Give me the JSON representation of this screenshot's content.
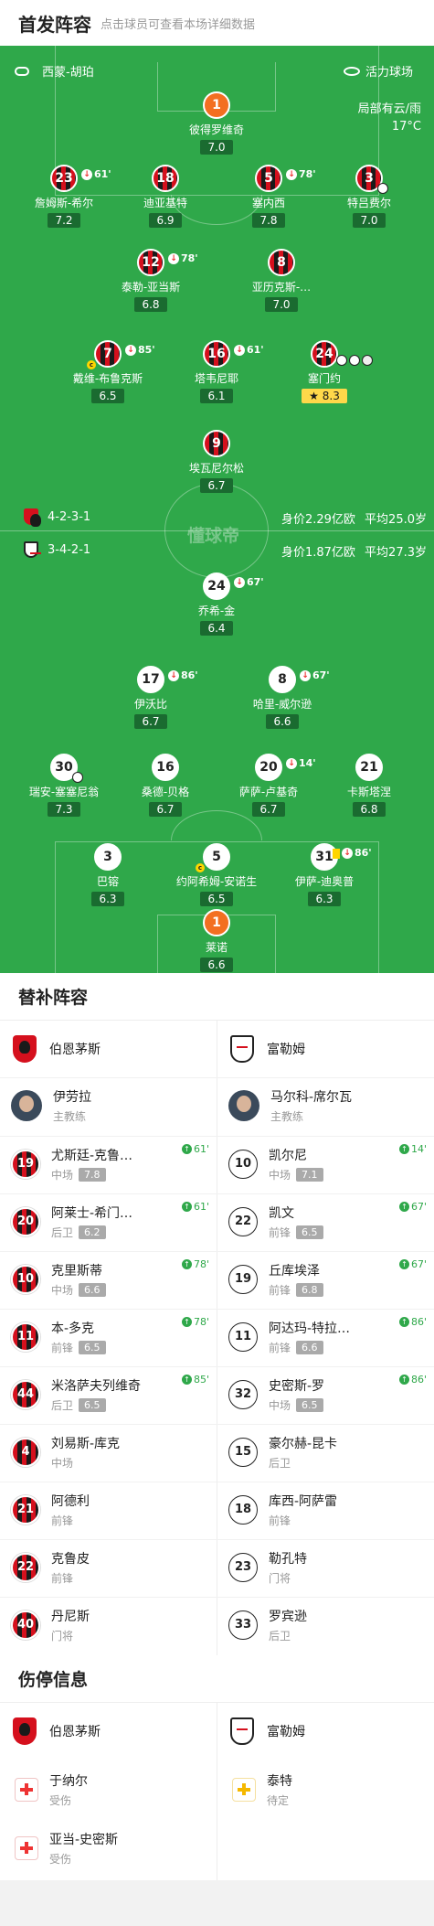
{
  "header": {
    "title": "首发阵容",
    "subtitle": "点击球员可查看本场详细数据"
  },
  "pitch": {
    "referee": "西蒙-胡珀",
    "stadium": "活力球场",
    "weather": "局部有云/雨",
    "temperature": "17°C",
    "watermark": "懂球帝",
    "home_formation": "4-2-3-1",
    "home_value": "身价2.29亿欧",
    "home_age": "平均25.0岁",
    "away_formation": "3-4-2-1",
    "away_value": "身价1.87亿欧",
    "away_age": "平均27.3岁"
  },
  "home_players": [
    {
      "num": "1",
      "name": "彼得罗维奇",
      "rating": "7.0",
      "kit": "gk"
    },
    {
      "num": "23",
      "name": "詹姆斯-希尔",
      "rating": "7.2",
      "sub": "61'"
    },
    {
      "num": "18",
      "name": "迪亚基特",
      "rating": "6.9"
    },
    {
      "num": "5",
      "name": "塞内西",
      "rating": "7.8",
      "sub": "78'"
    },
    {
      "num": "3",
      "name": "特吕费尔",
      "rating": "7.0"
    },
    {
      "num": "12",
      "name": "泰勒-亚当斯",
      "rating": "6.8",
      "sub": "78'"
    },
    {
      "num": "8",
      "name": "亚历克斯-…",
      "rating": "7.0"
    },
    {
      "num": "7",
      "name": "戴维-布鲁克斯",
      "rating": "6.5",
      "sub": "85'"
    },
    {
      "num": "16",
      "name": "塔韦尼耶",
      "rating": "6.1",
      "sub": "61'"
    },
    {
      "num": "24",
      "name": "塞门约",
      "rating": "8.3"
    },
    {
      "num": "9",
      "name": "埃瓦尼尔松",
      "rating": "6.7"
    }
  ],
  "away_players": [
    {
      "num": "24",
      "name": "乔希-金",
      "rating": "6.4",
      "sub": "67'"
    },
    {
      "num": "17",
      "name": "伊沃比",
      "rating": "6.7",
      "sub": "86'"
    },
    {
      "num": "8",
      "name": "哈里-威尔逊",
      "rating": "6.6",
      "sub": "67'"
    },
    {
      "num": "30",
      "name": "瑞安-塞塞尼翁",
      "rating": "7.3"
    },
    {
      "num": "16",
      "name": "桑德-贝格",
      "rating": "6.7"
    },
    {
      "num": "20",
      "name": "萨萨-卢基奇",
      "rating": "6.7",
      "sub": "14'"
    },
    {
      "num": "21",
      "name": "卡斯塔涅",
      "rating": "6.8"
    },
    {
      "num": "3",
      "name": "巴镕",
      "rating": "6.3"
    },
    {
      "num": "5",
      "name": "约阿希姆-安诺生",
      "rating": "6.5"
    },
    {
      "num": "31",
      "name": "伊萨-迪奥普",
      "rating": "6.3",
      "sub": "86'"
    },
    {
      "num": "1",
      "name": "莱诺",
      "rating": "6.6",
      "kit": "gk"
    }
  ],
  "subs": {
    "title": "替补阵容",
    "home_team": "伯恩茅斯",
    "away_team": "富勒姆",
    "home_coach": {
      "name": "伊劳拉",
      "role": "主教练"
    },
    "away_coach": {
      "name": "马尔科-席尔瓦",
      "role": "主教练"
    },
    "home": [
      {
        "num": "19",
        "name": "尤斯廷-克鲁…",
        "pos": "中场",
        "rating": "7.8",
        "min": "61'"
      },
      {
        "num": "20",
        "name": "阿莱士-希门…",
        "pos": "后卫",
        "rating": "6.2",
        "min": "61'"
      },
      {
        "num": "10",
        "name": "克里斯蒂",
        "pos": "中场",
        "rating": "6.6",
        "min": "78'"
      },
      {
        "num": "11",
        "name": "本-多克",
        "pos": "前锋",
        "rating": "6.5",
        "min": "78'"
      },
      {
        "num": "44",
        "name": "米洛萨夫列维奇",
        "pos": "后卫",
        "rating": "6.5",
        "min": "85'"
      },
      {
        "num": "4",
        "name": "刘易斯-库克",
        "pos": "中场",
        "rating": "",
        "min": ""
      },
      {
        "num": "21",
        "name": "阿德利",
        "pos": "前锋",
        "rating": "",
        "min": ""
      },
      {
        "num": "22",
        "name": "克鲁皮",
        "pos": "前锋",
        "rating": "",
        "min": ""
      },
      {
        "num": "40",
        "name": "丹尼斯",
        "pos": "门将",
        "rating": "",
        "min": ""
      }
    ],
    "away": [
      {
        "num": "10",
        "name": "凯尔尼",
        "pos": "中场",
        "rating": "7.1",
        "min": "14'"
      },
      {
        "num": "22",
        "name": "凯文",
        "pos": "前锋",
        "rating": "6.5",
        "min": "67'"
      },
      {
        "num": "19",
        "name": "丘库埃泽",
        "pos": "前锋",
        "rating": "6.8",
        "min": "67'"
      },
      {
        "num": "11",
        "name": "阿达玛-特拉…",
        "pos": "前锋",
        "rating": "6.6",
        "min": "86'"
      },
      {
        "num": "32",
        "name": "史密斯-罗",
        "pos": "中场",
        "rating": "6.5",
        "min": "86'"
      },
      {
        "num": "15",
        "name": "豪尔赫-昆卡",
        "pos": "后卫",
        "rating": "",
        "min": ""
      },
      {
        "num": "18",
        "name": "库西-阿萨雷",
        "pos": "前锋",
        "rating": "",
        "min": ""
      },
      {
        "num": "23",
        "name": "勒孔特",
        "pos": "门将",
        "rating": "",
        "min": ""
      },
      {
        "num": "33",
        "name": "罗宾逊",
        "pos": "后卫",
        "rating": "",
        "min": ""
      }
    ]
  },
  "injuries": {
    "title": "伤停信息",
    "home": [
      {
        "name": "于纳尔",
        "status": "受伤"
      },
      {
        "name": "亚当-史密斯",
        "status": "受伤"
      }
    ],
    "away": [
      {
        "name": "泰特",
        "status": "待定"
      }
    ]
  },
  "icons": {
    "whistle": "whistle-icon",
    "stadium": "stadium-icon"
  }
}
